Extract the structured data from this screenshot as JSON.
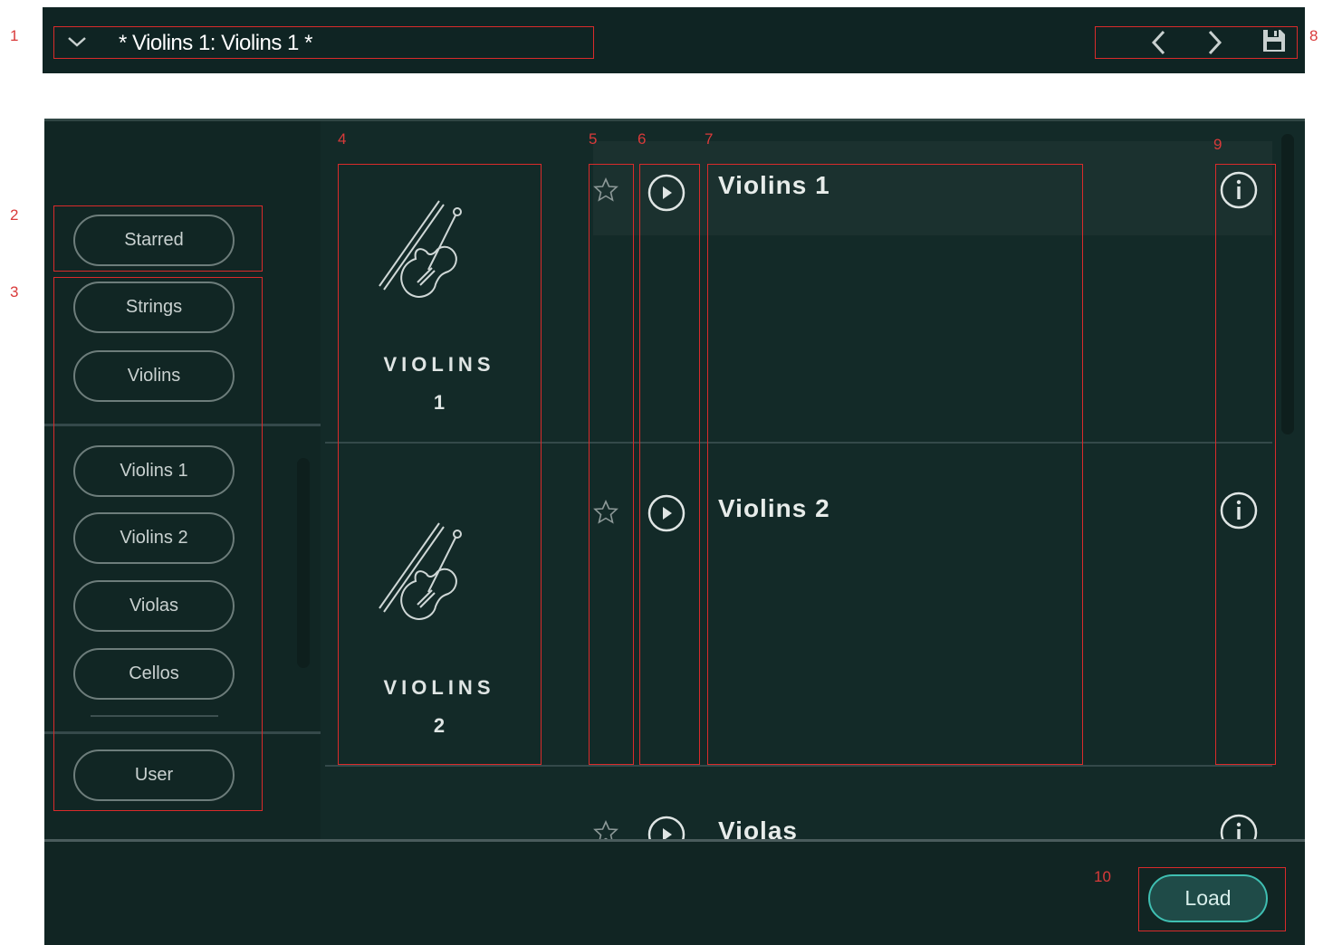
{
  "header": {
    "preset_title": "* Violins 1: Violins 1 *"
  },
  "sidebar": {
    "starred": "Starred",
    "groups": [
      "Strings",
      "Violins"
    ],
    "instruments": [
      "Violins 1",
      "Violins 2",
      "Violas",
      "Cellos"
    ],
    "user": "User"
  },
  "presets": [
    {
      "art_label": "VIOLINS",
      "art_number": "1",
      "name": "Violins 1"
    },
    {
      "art_label": "VIOLINS",
      "art_number": "2",
      "name": "Violins 2"
    },
    {
      "name": "Violas"
    }
  ],
  "footer": {
    "load_label": "Load"
  },
  "callouts": [
    "1",
    "2",
    "3",
    "4",
    "5",
    "6",
    "7",
    "8",
    "9",
    "10"
  ],
  "colors": {
    "background": "#132a28",
    "header": "#0f2423",
    "accent": "#3fbfb2",
    "callout": "#d93a3a"
  }
}
